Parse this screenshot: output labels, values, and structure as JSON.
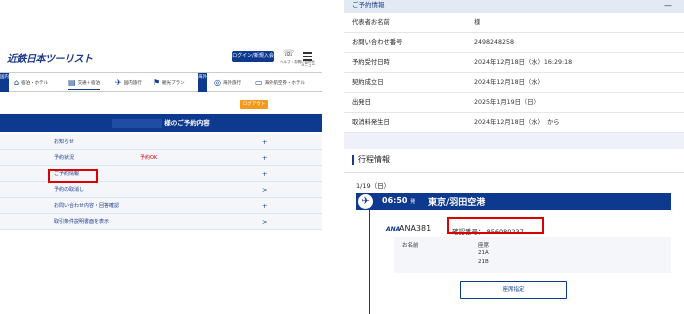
{
  "left": {
    "logo": "近鉄日本ツーリスト",
    "login_button": "ログイン/新規入会",
    "phone_label": "ヘルプ・お問い合わせ",
    "menu_label": "メニュー",
    "nav_tag_domestic": "国内",
    "nav_tag_overseas": "海外",
    "nav": [
      {
        "label": "宿泊・ホテル",
        "icon": "hotel-icon"
      },
      {
        "label": "交通＋宿泊",
        "icon": "train-hotel-icon"
      },
      {
        "label": "国内旅行",
        "icon": "domestic-tour-icon"
      },
      {
        "label": "観光プラン",
        "icon": "sightseeing-icon"
      },
      {
        "label": "海外旅行",
        "icon": "overseas-tour-icon"
      },
      {
        "label": "海外航空券・ホテル",
        "icon": "overseas-ticket-icon"
      }
    ],
    "logout": "ログアウト",
    "header_title": "様のご予約内容",
    "rows": [
      {
        "label": "お知らせ",
        "value": "",
        "action": "+"
      },
      {
        "label": "予約状況",
        "value": "予約OK",
        "action": "+"
      },
      {
        "label": "ご予約情報",
        "value": "",
        "action": "+"
      },
      {
        "label": "予約の取消し",
        "value": "",
        "action": ">"
      },
      {
        "label": "お問い合わせ内容・回答確認",
        "value": "",
        "action": "+"
      },
      {
        "label": "取引条件説明書面を表示",
        "value": "",
        "action": ">"
      }
    ]
  },
  "right": {
    "section_title": "ご予約情報",
    "collapse": "—",
    "info": [
      {
        "label": "代表者お名前",
        "value": "様"
      },
      {
        "label": "お問い合わせ番号",
        "value": "2498248258"
      },
      {
        "label": "予約受付日時",
        "value": "2024年12月18日（水）16:29:18"
      },
      {
        "label": "契約成立日",
        "value": "2024年12月18日（水）"
      },
      {
        "label": "出発日",
        "value": "2025年1月19日（日）"
      },
      {
        "label": "取消料発生日",
        "value": "2024年12月18日（水）　から"
      }
    ],
    "itinerary_title": "行程情報",
    "date": "1/19（日）",
    "flight_time": "06:50",
    "flight_time_suffix": "発",
    "flight_dest": "東京/羽田空港",
    "airline_logo": "ANA",
    "flight_number": "ANA381",
    "confirmation_label": "確認番号：",
    "confirmation_number": "856080237",
    "passenger_label": "お名前",
    "seat_header": "座席",
    "seats": [
      "21A",
      "21B"
    ],
    "seat_button": "座席指定"
  },
  "colors": {
    "brand": "#0d3a8f",
    "accent": "#f39a1e",
    "highlight": "#dd0000"
  }
}
